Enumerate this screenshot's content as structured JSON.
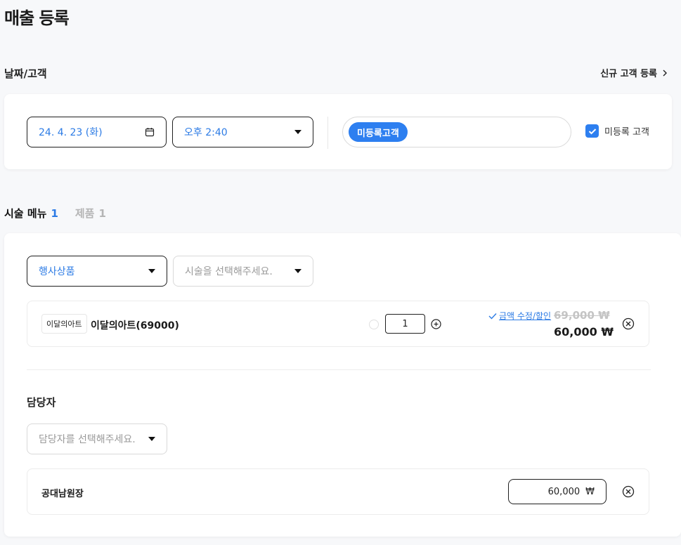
{
  "page": {
    "title": "매출 등록"
  },
  "date_customer": {
    "section_label": "날짜/고객",
    "new_customer_link": "신규 고객 등록",
    "date_value": "24. 4. 23 (화)",
    "time_value": "오후 2:40",
    "customer_chip": "미등록고객",
    "unregistered_label": "미등록 고객",
    "unregistered_checked": true
  },
  "tabs": [
    {
      "label": "시술 메뉴",
      "count": "1",
      "active": true
    },
    {
      "label": "제품",
      "count": "1",
      "active": false
    }
  ],
  "service": {
    "category_value": "행사상품",
    "service_placeholder": "시술을 선택해주세요.",
    "item": {
      "tag": "이달의아트",
      "name": "이달의아트(69000)",
      "quantity": "1",
      "edit_link": "금액 수정/할인",
      "original_price": "69,000 ₩",
      "final_price": "60,000 ₩"
    }
  },
  "staff": {
    "title": "담당자",
    "select_placeholder": "담당자를 선택해주세요.",
    "row": {
      "name": "공대남원장",
      "amount": "60,000",
      "currency": "₩"
    }
  },
  "colors": {
    "accent": "#2d7ff0",
    "text": "#1f1f1f",
    "muted": "#9a9a9a",
    "background": "#f7f8fa"
  }
}
